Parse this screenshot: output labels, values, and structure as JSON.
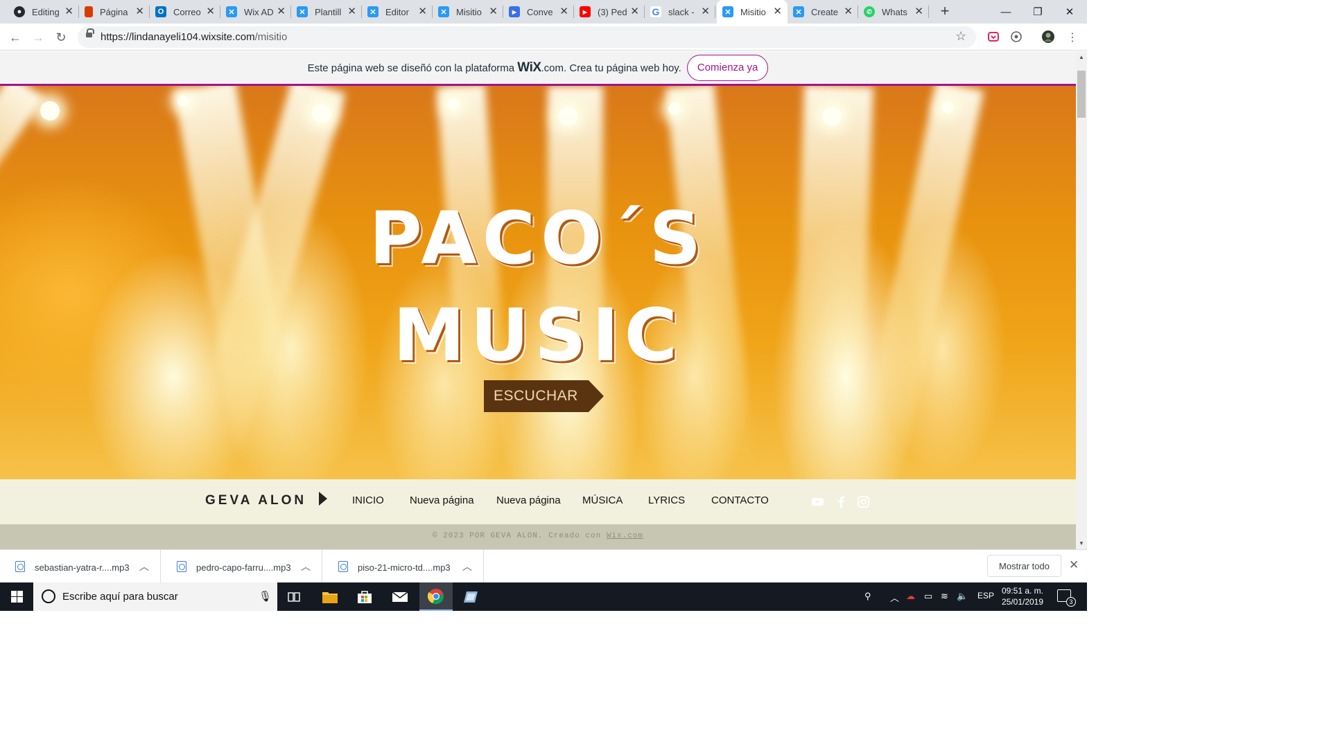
{
  "browser": {
    "tabs": [
      {
        "title": "Editing",
        "icon": "github-icon",
        "color": "#24292e"
      },
      {
        "title": "Página",
        "icon": "office-icon",
        "color": "#d83b01"
      },
      {
        "title": "Correo",
        "icon": "outlook-icon",
        "color": "#0072c6"
      },
      {
        "title": "Wix AD",
        "icon": "wix-ade-icon",
        "color": "#2b9af3"
      },
      {
        "title": "Plantill",
        "icon": "wix-ade-icon",
        "color": "#2b9af3"
      },
      {
        "title": "Editor",
        "icon": "wix-ade-icon",
        "color": "#2b9af3"
      },
      {
        "title": "Misitio",
        "icon": "wix-ade-icon",
        "color": "#2b9af3"
      },
      {
        "title": "Conve",
        "icon": "video-icon",
        "color": "#3b6ee8"
      },
      {
        "title": "(3) Ped",
        "icon": "youtube-icon",
        "color": "#ff0000"
      },
      {
        "title": "slack -",
        "icon": "google-icon",
        "color": "#4285f4"
      },
      {
        "title": "Misitio",
        "icon": "wix-ade-icon",
        "color": "#2b9af3"
      },
      {
        "title": "Create",
        "icon": "wix-ade-icon",
        "color": "#2b9af3"
      },
      {
        "title": "Whats",
        "icon": "whatsapp-icon",
        "color": "#25d366"
      }
    ],
    "active_tab_index": 10,
    "url_host": "https://lindanayeli104.wixsite.com",
    "url_path": "/misitio"
  },
  "wix_banner": {
    "prefix": "Este página web se diseñó con la plataforma",
    "brand": "WiX",
    "suffix": ".com. Crea tu página web hoy.",
    "cta": "Comienza ya",
    "accent": "#a0138e"
  },
  "hero": {
    "title_line1": "PACO´S",
    "title_line2": "MUSIC",
    "button": "ESCUCHAR",
    "button_color": "#5a3410"
  },
  "site_nav": {
    "brand": "GEVA ALON",
    "items": [
      "INICIO",
      "Nueva página",
      "Nueva página",
      "MÚSICA",
      "LYRICS",
      "CONTACTO"
    ],
    "social": [
      "youtube-icon",
      "facebook-icon",
      "instagram-icon"
    ]
  },
  "footer": {
    "copy": "© 2023 POR GEVA ALON. Creado con",
    "link": "Wix.com"
  },
  "downloads": {
    "items": [
      "sebastian-yatra-r....mp3",
      "pedro-capo-farru....mp3",
      "piso-21-micro-td....mp3"
    ],
    "show_all": "Mostrar todo"
  },
  "taskbar": {
    "search_placeholder": "Escribe aquí para buscar",
    "language": "ESP",
    "time": "09:51 a. m.",
    "date": "25/01/2019",
    "notification_count": "3"
  }
}
